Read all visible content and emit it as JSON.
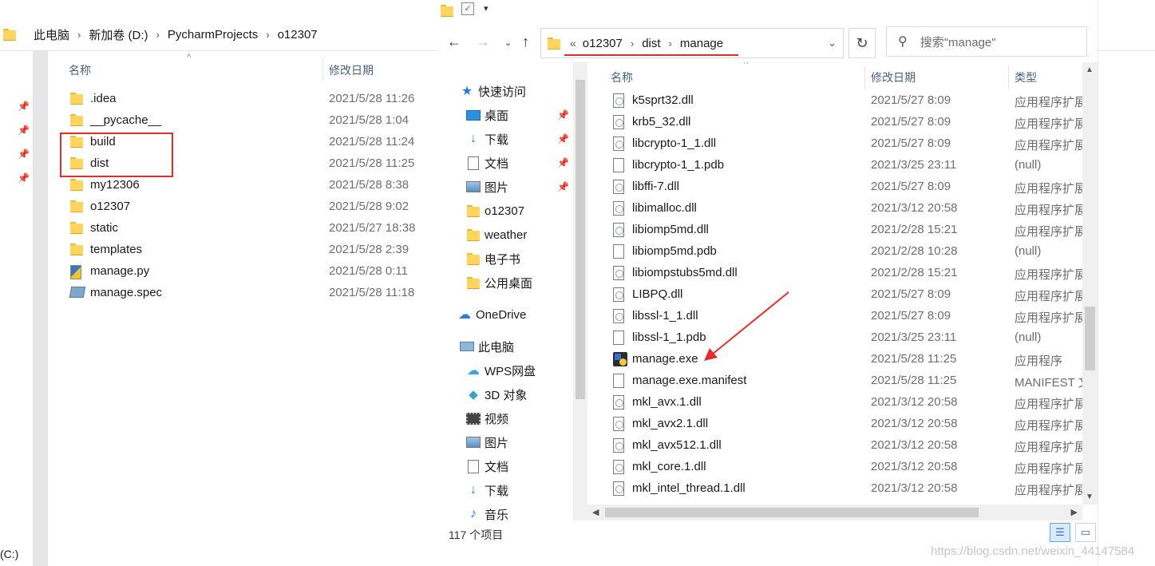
{
  "left_window": {
    "breadcrumb": [
      "此电脑",
      "新加卷 (D:)",
      "PycharmProjects",
      "o12307"
    ],
    "columns": {
      "name": "名称",
      "date": "修改日期"
    },
    "drive_label": "(C:)",
    "files": [
      {
        "name": ".idea",
        "date": "2021/5/28 11:26",
        "icon": "folder-icon"
      },
      {
        "name": "__pycache__",
        "date": "2021/5/28 1:04",
        "icon": "folder-icon"
      },
      {
        "name": "build",
        "date": "2021/5/28 11:24",
        "icon": "folder-icon"
      },
      {
        "name": "dist",
        "date": "2021/5/28 11:25",
        "icon": "folder-icon"
      },
      {
        "name": "my12306",
        "date": "2021/5/28 8:38",
        "icon": "folder-icon"
      },
      {
        "name": "o12307",
        "date": "2021/5/28 9:02",
        "icon": "folder-icon"
      },
      {
        "name": "static",
        "date": "2021/5/27 18:38",
        "icon": "folder-icon"
      },
      {
        "name": "templates",
        "date": "2021/5/28 2:39",
        "icon": "folder-icon"
      },
      {
        "name": "manage.py",
        "date": "2021/5/28 0:11",
        "icon": "python-file-icon"
      },
      {
        "name": "manage.spec",
        "date": "2021/5/28 11:18",
        "icon": "spec-file-icon"
      }
    ]
  },
  "right_window": {
    "address": {
      "overflow": "«",
      "parts": [
        "o12307",
        "dist",
        "manage"
      ]
    },
    "search": {
      "placeholder": "搜索\"manage\""
    },
    "columns": {
      "name": "名称",
      "date": "修改日期",
      "type": "类型"
    },
    "nav": [
      {
        "label": "快速访问",
        "icon": "star-icon",
        "pinned": false
      },
      {
        "label": "桌面",
        "icon": "desktop-icon",
        "pinned": true
      },
      {
        "label": "下载",
        "icon": "download-icon",
        "pinned": true
      },
      {
        "label": "文档",
        "icon": "document-icon",
        "pinned": true
      },
      {
        "label": "图片",
        "icon": "picture-icon",
        "pinned": true
      },
      {
        "label": "o12307",
        "icon": "folder-icon",
        "pinned": false
      },
      {
        "label": "weather",
        "icon": "folder-icon",
        "pinned": false
      },
      {
        "label": "电子书",
        "icon": "folder-icon",
        "pinned": false
      },
      {
        "label": "公用桌面",
        "icon": "folder-icon",
        "pinned": false
      },
      {
        "label": "OneDrive",
        "icon": "cloud-icon",
        "pinned": false
      },
      {
        "label": "此电脑",
        "icon": "computer-icon",
        "pinned": false
      },
      {
        "label": "WPS网盘",
        "icon": "wps-cloud-icon",
        "pinned": false
      },
      {
        "label": "3D 对象",
        "icon": "cube-icon",
        "pinned": false
      },
      {
        "label": "视频",
        "icon": "video-icon",
        "pinned": false
      },
      {
        "label": "图片",
        "icon": "picture-icon",
        "pinned": false
      },
      {
        "label": "文档",
        "icon": "document-icon",
        "pinned": false
      },
      {
        "label": "下载",
        "icon": "download-icon",
        "pinned": false
      },
      {
        "label": "音乐",
        "icon": "music-icon",
        "pinned": false
      }
    ],
    "files": [
      {
        "name": "k5sprt32.dll",
        "date": "2021/5/27 8:09",
        "type": "应用程序扩展",
        "icon": "dll-icon"
      },
      {
        "name": "krb5_32.dll",
        "date": "2021/5/27 8:09",
        "type": "应用程序扩展",
        "icon": "dll-icon"
      },
      {
        "name": "libcrypto-1_1.dll",
        "date": "2021/5/27 8:09",
        "type": "应用程序扩展",
        "icon": "dll-icon"
      },
      {
        "name": "libcrypto-1_1.pdb",
        "date": "2021/3/25 23:11",
        "type": "(null)",
        "icon": "file-icon"
      },
      {
        "name": "libffi-7.dll",
        "date": "2021/5/27 8:09",
        "type": "应用程序扩展",
        "icon": "dll-icon"
      },
      {
        "name": "libimalloc.dll",
        "date": "2021/3/12 20:58",
        "type": "应用程序扩展",
        "icon": "dll-icon"
      },
      {
        "name": "libiomp5md.dll",
        "date": "2021/2/28 15:21",
        "type": "应用程序扩展",
        "icon": "dll-icon"
      },
      {
        "name": "libiomp5md.pdb",
        "date": "2021/2/28 10:28",
        "type": "(null)",
        "icon": "file-icon"
      },
      {
        "name": "libiompstubs5md.dll",
        "date": "2021/2/28 15:21",
        "type": "应用程序扩展",
        "icon": "dll-icon"
      },
      {
        "name": "LIBPQ.dll",
        "date": "2021/5/27 8:09",
        "type": "应用程序扩展",
        "icon": "dll-icon"
      },
      {
        "name": "libssl-1_1.dll",
        "date": "2021/5/27 8:09",
        "type": "应用程序扩展",
        "icon": "dll-icon"
      },
      {
        "name": "libssl-1_1.pdb",
        "date": "2021/3/25 23:11",
        "type": "(null)",
        "icon": "file-icon"
      },
      {
        "name": "manage.exe",
        "date": "2021/5/28 11:25",
        "type": "应用程序",
        "icon": "exe-icon"
      },
      {
        "name": "manage.exe.manifest",
        "date": "2021/5/28 11:25",
        "type": "MANIFEST 文件",
        "icon": "file-icon"
      },
      {
        "name": "mkl_avx.1.dll",
        "date": "2021/3/12 20:58",
        "type": "应用程序扩展",
        "icon": "dll-icon"
      },
      {
        "name": "mkl_avx2.1.dll",
        "date": "2021/3/12 20:58",
        "type": "应用程序扩展",
        "icon": "dll-icon"
      },
      {
        "name": "mkl_avx512.1.dll",
        "date": "2021/3/12 20:58",
        "type": "应用程序扩展",
        "icon": "dll-icon"
      },
      {
        "name": "mkl_core.1.dll",
        "date": "2021/3/12 20:58",
        "type": "应用程序扩展",
        "icon": "dll-icon"
      },
      {
        "name": "mkl_intel_thread.1.dll",
        "date": "2021/3/12 20:58",
        "type": "应用程序扩展",
        "icon": "dll-icon"
      }
    ],
    "status": "117 个项目"
  },
  "watermark": "https://blog.csdn.net/weixin_44147584",
  "colors": {
    "highlight_red": "#e02e2e",
    "header_blue": "#4c607a",
    "folder_yellow": "#ffd55e"
  }
}
